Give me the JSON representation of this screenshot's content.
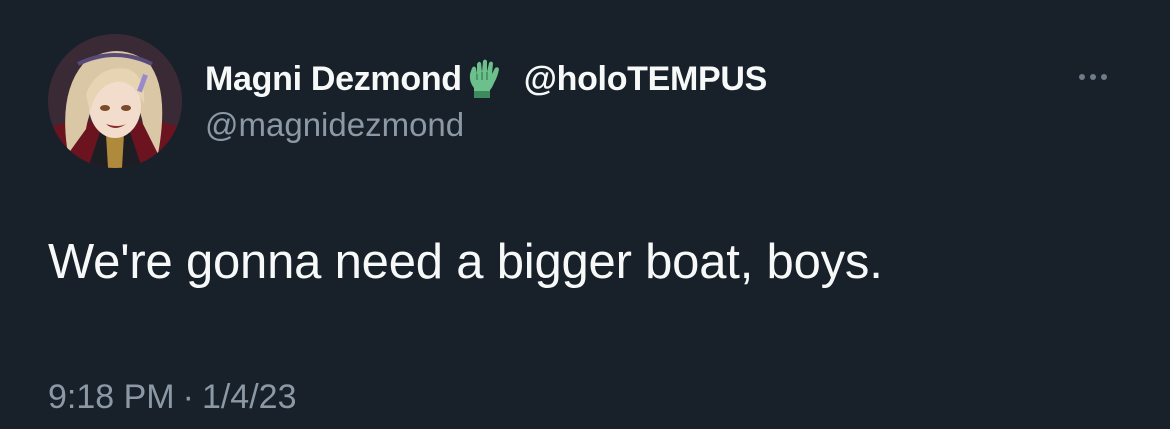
{
  "author": {
    "display_name": "Magni Dezmond",
    "badge_icon": "green-glove-icon",
    "affiliation": "@holoTEMPUS",
    "handle": "@magnidezmond",
    "avatar": "avatar-image"
  },
  "tweet": {
    "text": "We're gonna need a bigger boat, boys.",
    "time": "9:18 PM",
    "separator": "·",
    "date": "1/4/23"
  },
  "actions": {
    "more_icon": "more-options-icon"
  },
  "colors": {
    "background": "#182029",
    "primary_text": "#f7f9f9",
    "secondary_text": "#8b98a5",
    "badge_green": "#6cc08b"
  }
}
